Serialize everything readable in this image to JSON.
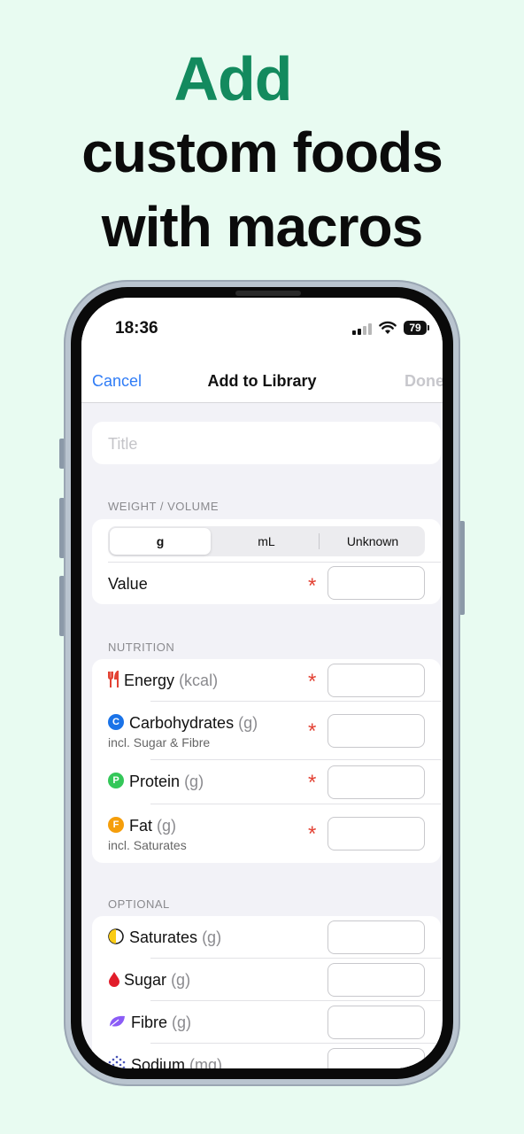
{
  "headline": {
    "line1": "Add",
    "line2": "custom foods",
    "line3": "with macros"
  },
  "status": {
    "time": "18:36",
    "battery": "79"
  },
  "nav": {
    "cancel": "Cancel",
    "title": "Add to Library",
    "done": "Done"
  },
  "form": {
    "title_placeholder": "Title",
    "weight_section": "WEIGHT / VOLUME",
    "units": [
      "g",
      "mL",
      "Unknown"
    ],
    "selected_unit": "g",
    "value_label": "Value",
    "nutrition_section": "NUTRITION",
    "nutrition": [
      {
        "label": "Energy",
        "unit": "(kcal)",
        "sub": "",
        "icon": "fork-knife-icon"
      },
      {
        "label": "Carbohydrates",
        "unit": "(g)",
        "sub": "incl. Sugar & Fibre",
        "icon": "C"
      },
      {
        "label": "Protein",
        "unit": "(g)",
        "sub": "",
        "icon": "P"
      },
      {
        "label": "Fat",
        "unit": "(g)",
        "sub": "incl. Saturates",
        "icon": "F"
      }
    ],
    "required_marker": "*",
    "optional_section": "OPTIONAL",
    "optional": [
      {
        "label": "Saturates",
        "unit": "(g)",
        "icon": "half-circle-icon"
      },
      {
        "label": "Sugar",
        "unit": "(g)",
        "icon": "drop-icon"
      },
      {
        "label": "Fibre",
        "unit": "(g)",
        "icon": "leaf-icon"
      },
      {
        "label": "Sodium",
        "unit": "(mg)",
        "icon": "dots-icon"
      }
    ]
  },
  "colors": {
    "background": "#e8fbf1",
    "accent_green": "#138a5e",
    "link_blue": "#2f7cf6",
    "required_red": "#e34234",
    "carb_blue": "#1a73e8",
    "protein_green": "#34c759",
    "fat_orange": "#f59e0b",
    "sugar_red": "#e11d2a",
    "fibre_purple": "#8b5cf6",
    "sodium_blue": "#4a55b8"
  }
}
